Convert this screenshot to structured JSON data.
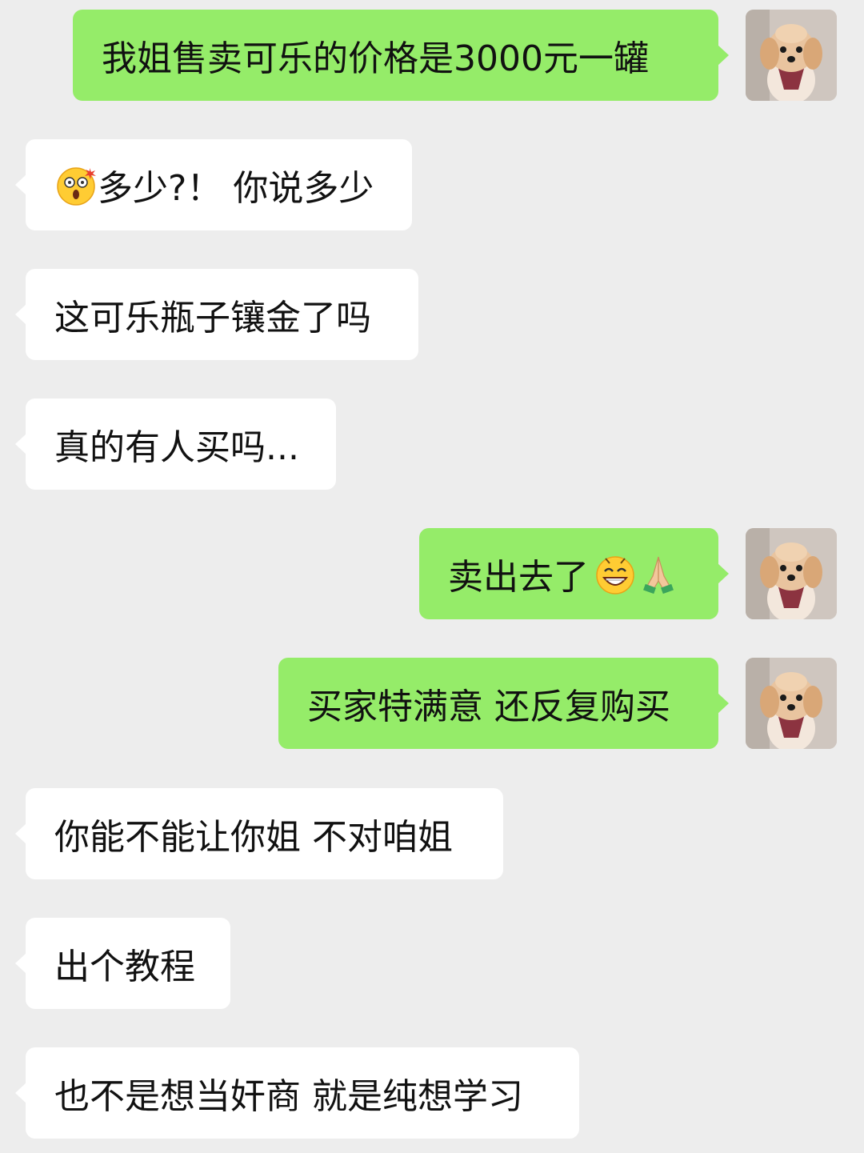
{
  "messages": [
    {
      "side": "out",
      "text": "我姐售卖可乐的价格是3000元一罐"
    },
    {
      "side": "in",
      "text": "多少?！ 你说多少",
      "emoji_before": "astonished-face-icon"
    },
    {
      "side": "in",
      "text": "这可乐瓶子镶金了吗"
    },
    {
      "side": "in",
      "text": "真的有人买吗..."
    },
    {
      "side": "out",
      "text": "卖出去了",
      "emoji_after": [
        "grinning-face-icon",
        "praying-hands-icon"
      ]
    },
    {
      "side": "out",
      "text": "买家特满意 还反复购买"
    },
    {
      "side": "in",
      "text": "你能不能让你姐 不对咱姐"
    },
    {
      "side": "in",
      "text": "出个教程"
    },
    {
      "side": "in",
      "text": "也不是想当奸商 就是纯想学习"
    }
  ],
  "avatar": {
    "icon": "puppy-avatar-icon"
  },
  "colors": {
    "background": "#EDEDED",
    "outgoing_bubble": "#95EC69",
    "incoming_bubble": "#FFFFFF",
    "text": "#111111"
  }
}
